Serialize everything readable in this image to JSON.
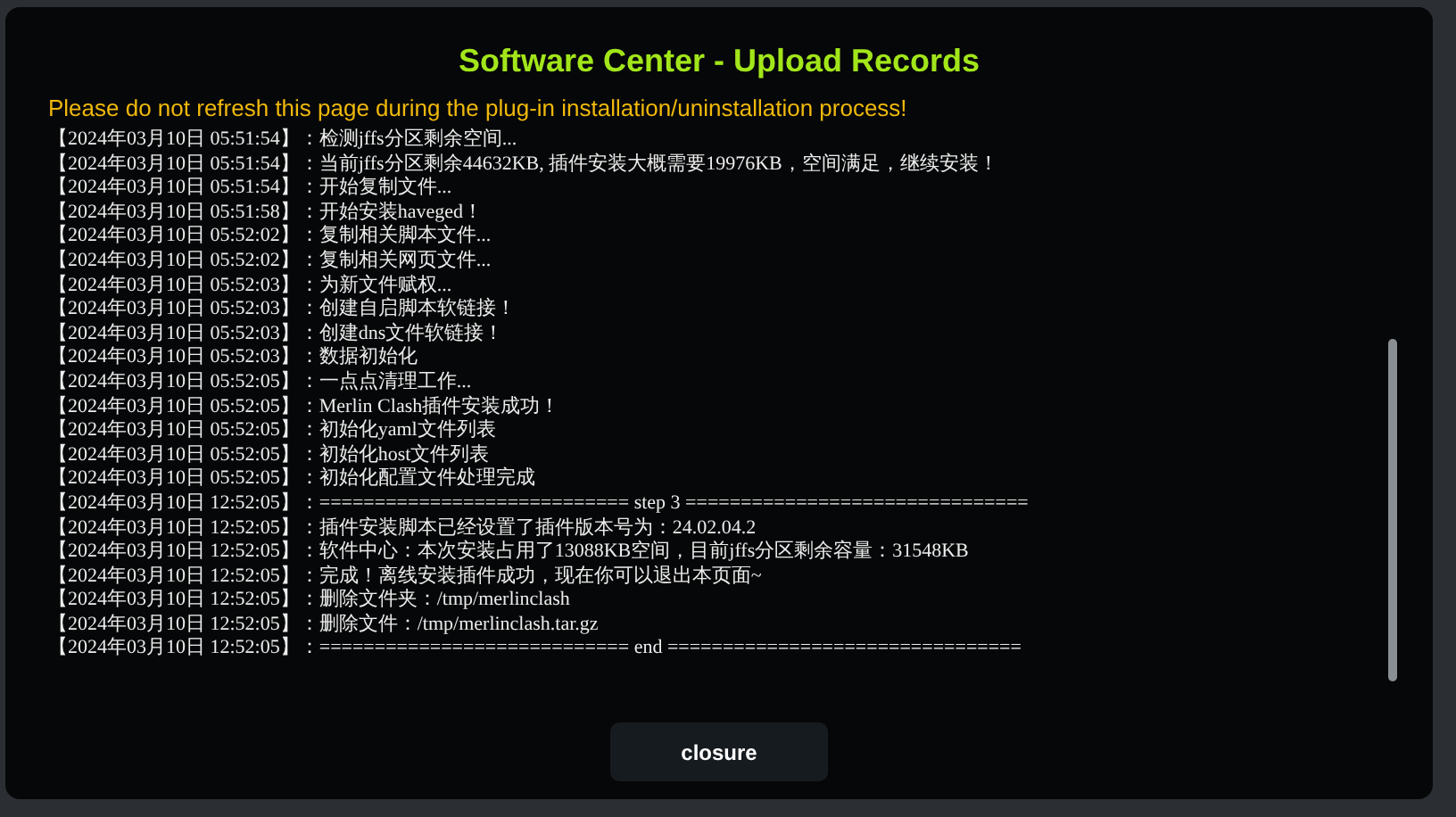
{
  "dialog": {
    "title": "Software Center - Upload Records",
    "warning": "Please do not refresh this page during the plug-in installation/uninstallation process!",
    "log_lines": [
      "【2024年03月10日 05:51:54】：检测jffs分区剩余空间...",
      "【2024年03月10日 05:51:54】：当前jffs分区剩余44632KB, 插件安装大概需要19976KB，空间满足，继续安装！",
      "【2024年03月10日 05:51:54】：开始复制文件...",
      "【2024年03月10日 05:51:58】：开始安装haveged！",
      "【2024年03月10日 05:52:02】：复制相关脚本文件...",
      "【2024年03月10日 05:52:02】：复制相关网页文件...",
      "【2024年03月10日 05:52:03】：为新文件赋权...",
      "【2024年03月10日 05:52:03】：创建自启脚本软链接！",
      "【2024年03月10日 05:52:03】：创建dns文件软链接！",
      "【2024年03月10日 05:52:03】：数据初始化",
      "【2024年03月10日 05:52:05】：一点点清理工作...",
      "【2024年03月10日 05:52:05】：Merlin Clash插件安装成功！",
      "【2024年03月10日 05:52:05】：初始化yaml文件列表",
      "【2024年03月10日 05:52:05】：初始化host文件列表",
      "【2024年03月10日 05:52:05】：初始化配置文件处理完成",
      "【2024年03月10日 12:52:05】：============================ step 3 ===============================",
      "【2024年03月10日 12:52:05】：插件安装脚本已经设置了插件版本号为：24.02.04.2",
      "【2024年03月10日 12:52:05】：软件中心：本次安装占用了13088KB空间，目前jffs分区剩余容量：31548KB",
      "【2024年03月10日 12:52:05】：完成！离线安装插件成功，现在你可以退出本页面~",
      "【2024年03月10日 12:52:05】：删除文件夹：/tmp/merlinclash",
      "【2024年03月10日 12:52:05】：删除文件：/tmp/merlinclash.tar.gz",
      "【2024年03月10日 12:52:05】：============================ end ================================"
    ],
    "button": "closure"
  }
}
